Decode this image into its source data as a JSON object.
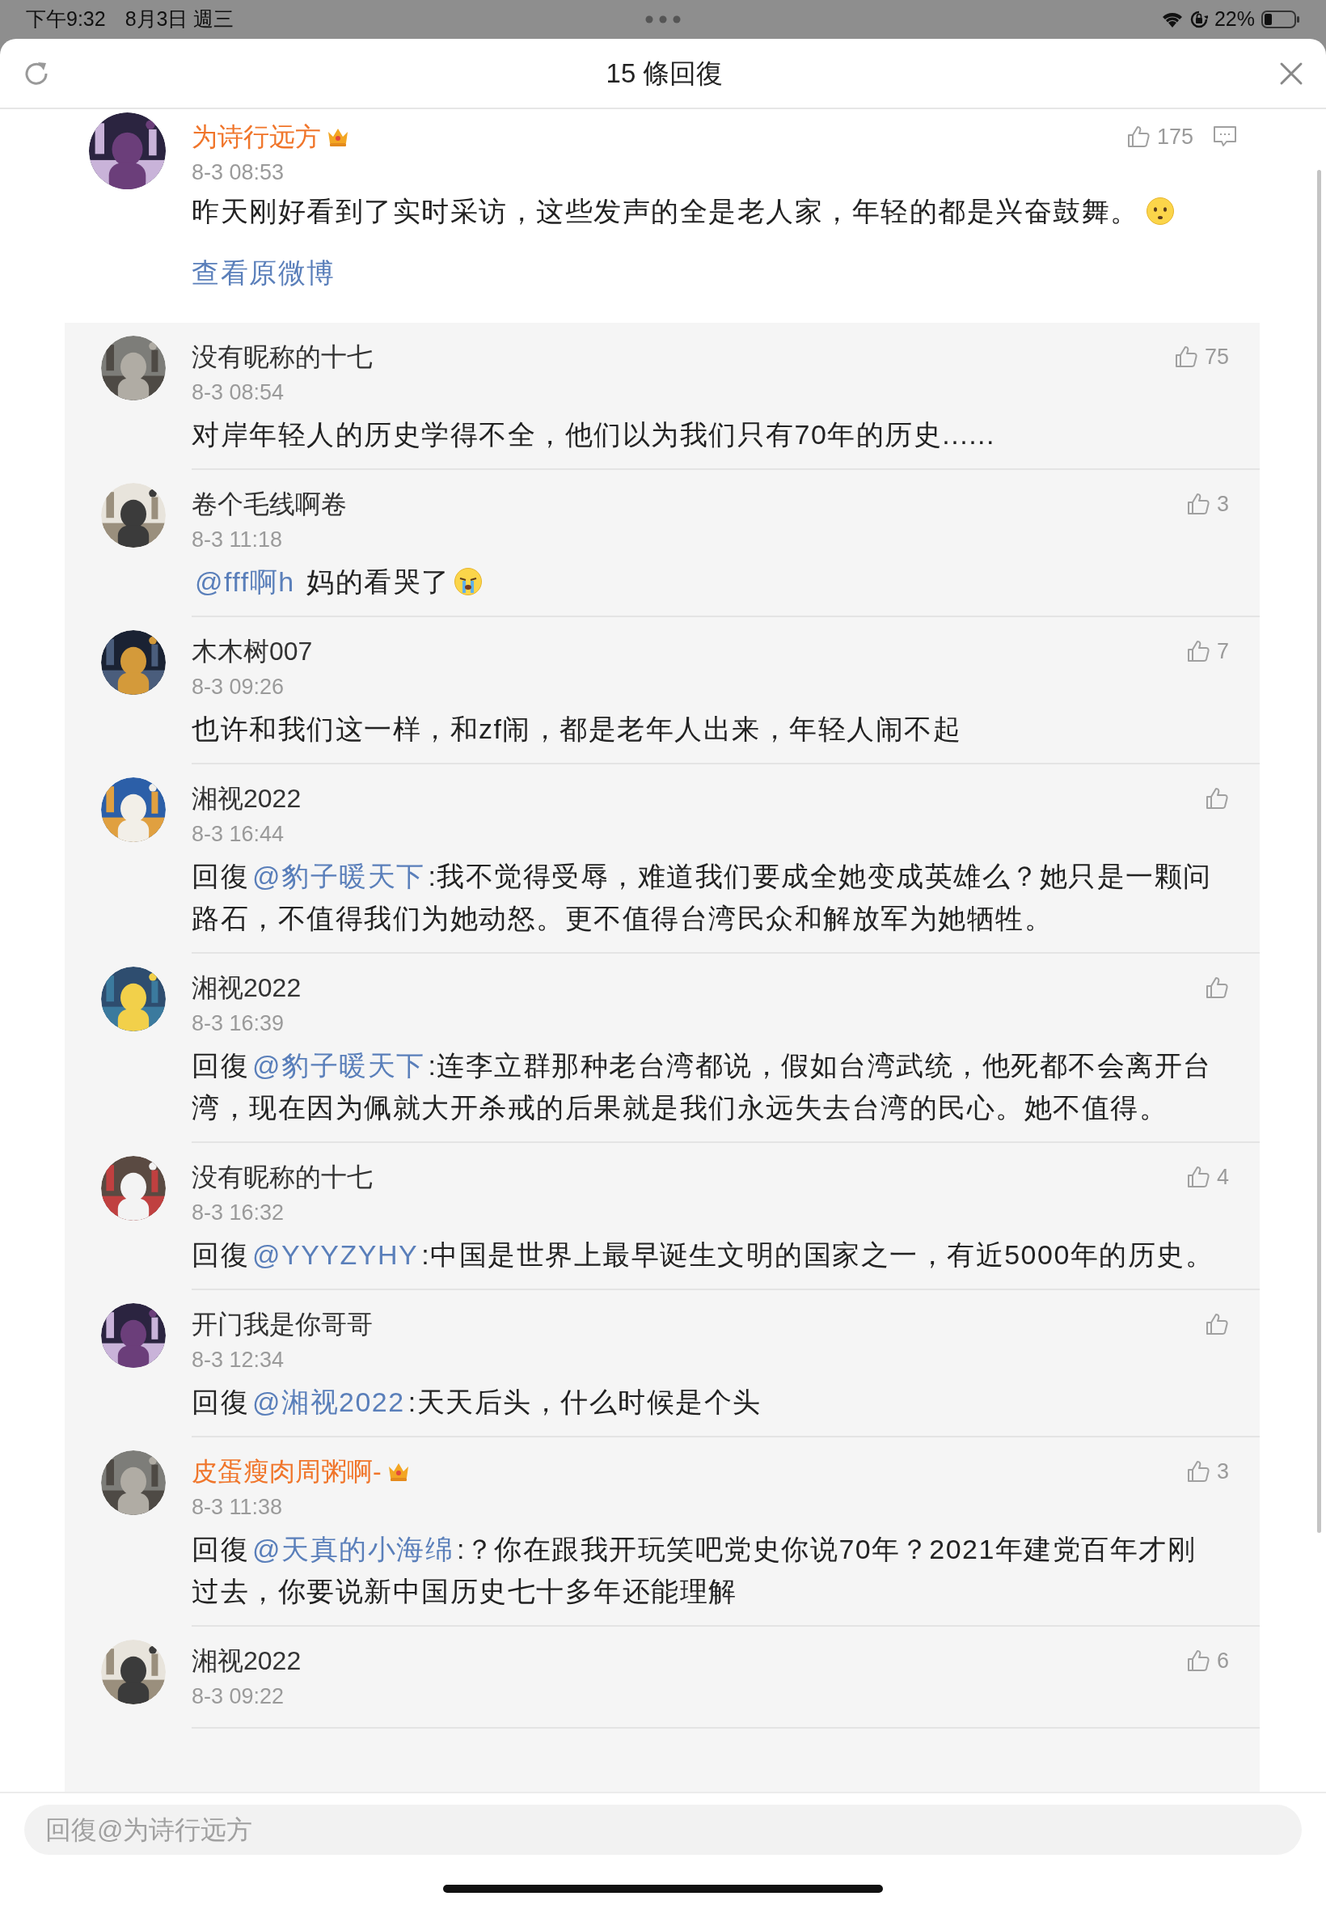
{
  "status_bar": {
    "time": "下午9:32",
    "date": "8月3日 週三",
    "battery": "22%"
  },
  "header": {
    "title": "15 條回復"
  },
  "comment": {
    "author": "为诗行远方",
    "vip": true,
    "time": "8-3 08:53",
    "likes": "175",
    "text": "昨天刚好看到了实时采访，这些发声的全是老人家，年轻的都是兴奋鼓舞。",
    "emoji": {
      "kind": "sad"
    },
    "link": "查看原微博"
  },
  "replies": [
    {
      "author": "没有昵称的十七",
      "vip": false,
      "time": "8-3 08:54",
      "likes": "75",
      "text": "对岸年轻人的历史学得不全，他们以为我们只有70年的历史......"
    },
    {
      "author": "卷个毛线啊卷",
      "vip": false,
      "time": "8-3 11:18",
      "likes": "3",
      "mention": "@fff啊h",
      "text": " 妈的看哭了",
      "emoji": {
        "kind": "crying"
      }
    },
    {
      "author": "木木树007",
      "vip": false,
      "time": "8-3 09:26",
      "likes": "7",
      "text": "也许和我们这一样，和zf闹，都是老年人出来，年轻人闹不起"
    },
    {
      "author": "湘视2022",
      "vip": false,
      "time": "8-3 16:44",
      "prefix": "回復",
      "mention": "@豹子暖天下",
      "text": ":我不觉得受辱，难道我们要成全她变成英雄么？她只是一颗问路石，不值得我们为她动怒。更不值得台湾民众和解放军为她牺牲。"
    },
    {
      "author": "湘视2022",
      "vip": false,
      "time": "8-3 16:39",
      "prefix": "回復",
      "mention": "@豹子暖天下",
      "text": ":连李立群那种老台湾都说，假如台湾武统，他死都不会离开台湾，现在因为佩就大开杀戒的后果就是我们永远失去台湾的民心。她不值得。"
    },
    {
      "author": "没有昵称的十七",
      "vip": false,
      "time": "8-3 16:32",
      "likes": "4",
      "prefix": "回復",
      "mention": "@YYYZYHY",
      "text": ":中国是世界上最早诞生文明的国家之一，有近5000年的历史。"
    },
    {
      "author": "开门我是你哥哥",
      "vip": false,
      "time": "8-3 12:34",
      "prefix": "回復",
      "mention": "@湘视2022",
      "text": ":天天后头，什么时候是个头"
    },
    {
      "author": "皮蛋瘦肉周粥啊-",
      "vip": true,
      "time": "8-3 11:38",
      "likes": "3",
      "prefix": "回復",
      "mention": "@天真的小海绵",
      "text": ":？你在跟我开玩笑吧党史你说70年？2021年建党百年才刚过去，你要说新中国历史七十多年还能理解"
    },
    {
      "author": "湘视2022",
      "vip": false,
      "time": "8-3 09:22",
      "likes": "6"
    }
  ],
  "reply_box": {
    "placeholder": "回復@为诗行远方"
  }
}
